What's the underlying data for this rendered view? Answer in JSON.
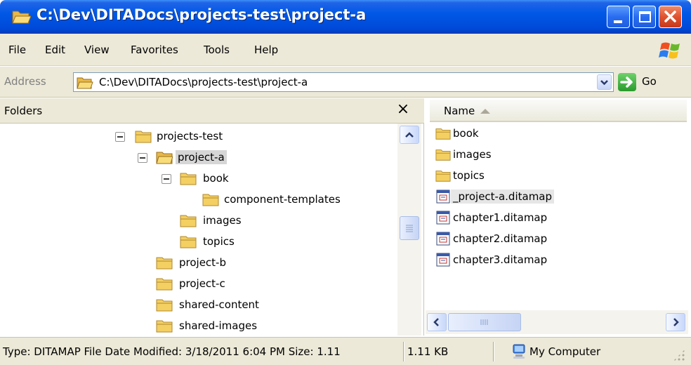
{
  "window": {
    "title": "C:\\Dev\\DITADocs\\projects-test\\project-a",
    "colors": {
      "titlebar": "#0058e6",
      "close": "#e0522e",
      "chrome": "#ece9d8",
      "selection": "#d6d6d6"
    }
  },
  "menu": {
    "items": [
      "File",
      "Edit",
      "View",
      "Favorites",
      "Tools",
      "Help"
    ]
  },
  "address": {
    "label": "Address",
    "value": "C:\\Dev\\DITADocs\\projects-test\\project-a",
    "go_label": "Go"
  },
  "folders_pane": {
    "title": "Folders",
    "close_glyph": "×",
    "tree": [
      {
        "label": "projects-test",
        "expanded": true,
        "icon": "folder-icon"
      },
      {
        "label": "project-a",
        "expanded": true,
        "selected": true,
        "icon": "folder-open-icon"
      },
      {
        "label": "book",
        "expanded": true,
        "icon": "folder-icon"
      },
      {
        "label": "component-templates",
        "icon": "folder-icon"
      },
      {
        "label": "images",
        "icon": "folder-icon"
      },
      {
        "label": "topics",
        "icon": "folder-icon"
      },
      {
        "label": "project-b",
        "icon": "folder-icon"
      },
      {
        "label": "project-c",
        "icon": "folder-icon"
      },
      {
        "label": "shared-content",
        "icon": "folder-icon"
      },
      {
        "label": "shared-images",
        "icon": "folder-icon"
      }
    ]
  },
  "files_pane": {
    "column_header": "Name",
    "sort": "ascending",
    "items": [
      {
        "label": "book",
        "type": "folder",
        "icon": "folder-icon"
      },
      {
        "label": "images",
        "type": "folder",
        "icon": "folder-icon"
      },
      {
        "label": "topics",
        "type": "folder",
        "icon": "folder-icon"
      },
      {
        "label": "_project-a.ditamap",
        "type": "file",
        "selected": true,
        "icon": "ditamap-file-icon"
      },
      {
        "label": "chapter1.ditamap",
        "type": "file",
        "icon": "ditamap-file-icon"
      },
      {
        "label": "chapter2.ditamap",
        "type": "file",
        "icon": "ditamap-file-icon"
      },
      {
        "label": "chapter3.ditamap",
        "type": "file",
        "icon": "ditamap-file-icon"
      }
    ]
  },
  "status": {
    "details": "Type: DITAMAP File Date Modified: 3/18/2011 6:04 PM Size: 1.11",
    "size": "1.11 KB",
    "zone": "My Computer"
  }
}
